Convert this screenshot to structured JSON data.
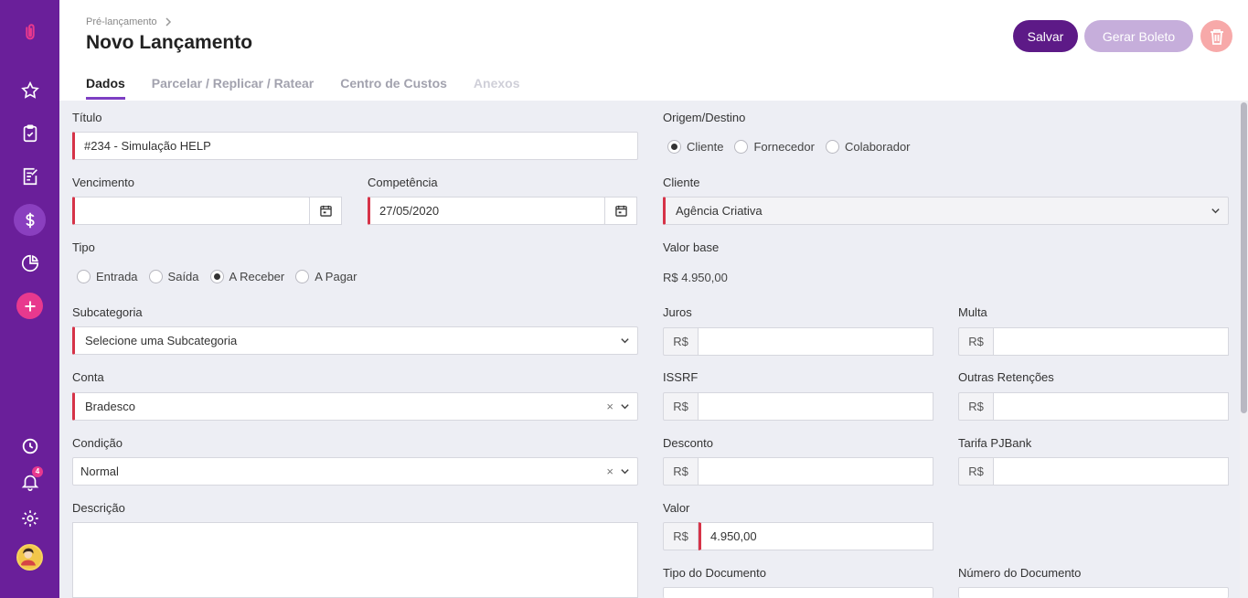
{
  "breadcrumb": "Pré-lançamento",
  "page_title": "Novo Lançamento",
  "buttons": {
    "save": "Salvar",
    "boleto": "Gerar Boleto"
  },
  "tabs": [
    "Dados",
    "Parcelar / Replicar / Ratear",
    "Centro de Custos",
    "Anexos"
  ],
  "sidebar": {
    "notifications_count": "4"
  },
  "form": {
    "titulo": {
      "label": "Título",
      "value": "#234 - Simulação HELP"
    },
    "vencimento": {
      "label": "Vencimento",
      "value": ""
    },
    "competencia": {
      "label": "Competência",
      "value": "27/05/2020"
    },
    "tipo": {
      "label": "Tipo",
      "options": [
        "Entrada",
        "Saída",
        "A Receber",
        "A Pagar"
      ],
      "selected": "A Receber"
    },
    "subcategoria": {
      "label": "Subcategoria",
      "value": "Selecione uma Subcategoria"
    },
    "conta": {
      "label": "Conta",
      "value": "Bradesco"
    },
    "condicao": {
      "label": "Condição",
      "value": "Normal"
    },
    "descricao": {
      "label": "Descrição",
      "value": ""
    },
    "origem": {
      "label": "Origem/Destino",
      "options": [
        "Cliente",
        "Fornecedor",
        "Colaborador"
      ],
      "selected": "Cliente"
    },
    "cliente": {
      "label": "Cliente",
      "value": "Agência Criativa"
    },
    "valor_base": {
      "label": "Valor base",
      "value": "R$ 4.950,00"
    },
    "currency": "R$",
    "juros": {
      "label": "Juros",
      "value": ""
    },
    "multa": {
      "label": "Multa",
      "value": ""
    },
    "issrf": {
      "label": "ISSRF",
      "value": ""
    },
    "outras": {
      "label": "Outras Retenções",
      "value": ""
    },
    "desconto": {
      "label": "Desconto",
      "value": ""
    },
    "tarifa": {
      "label": "Tarifa PJBank",
      "value": ""
    },
    "valor": {
      "label": "Valor",
      "value": "4.950,00"
    },
    "tipo_doc": {
      "label": "Tipo do Documento"
    },
    "numero_doc": {
      "label": "Número do Documento"
    }
  },
  "colors": {
    "sidebar": "#6a1f9a",
    "primary": "#5d1a87",
    "required": "#d63348",
    "accent_pink": "#e8398e"
  }
}
